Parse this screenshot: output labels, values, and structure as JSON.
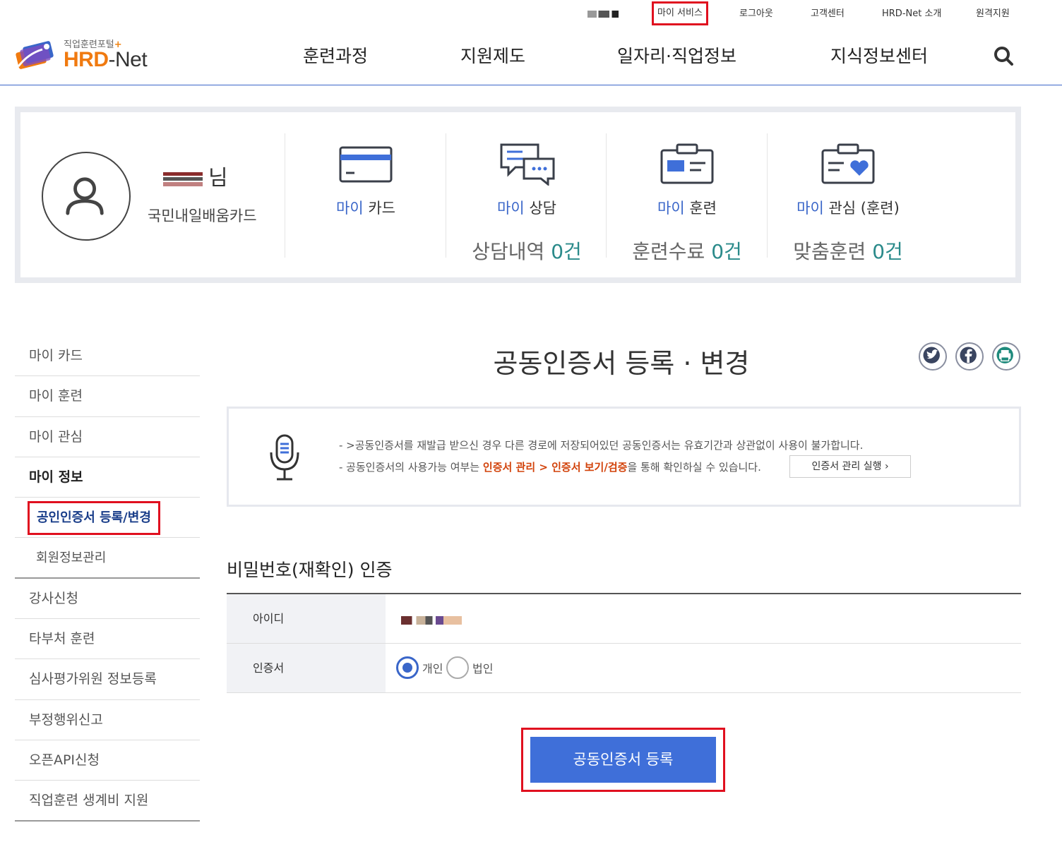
{
  "header": {
    "util": {
      "my_service": "마이 서비스",
      "logout": "로그아웃",
      "customer": "고객센터",
      "about": "HRD-Net 소개",
      "remote": "원격지원"
    },
    "logo": {
      "subtitle": "직업훈련포털",
      "plus": "+",
      "hrd": "HRD",
      "net": "-Net"
    },
    "gnb": [
      "훈련과정",
      "지원제도",
      "일자리·직업정보",
      "지식정보센터"
    ],
    "search_icon": "search-icon"
  },
  "profile": {
    "suffix": "님",
    "card_type": "국민내일배움카드",
    "items": [
      {
        "icon": "card-icon",
        "label_prefix": "마이",
        "label_rest": " 카드",
        "count_label": "",
        "count": ""
      },
      {
        "icon": "chat-icon",
        "label_prefix": "마이",
        "label_rest": " 상담",
        "count_label": "상담내역 ",
        "count": "0건"
      },
      {
        "icon": "training-icon",
        "label_prefix": "마이",
        "label_rest": " 훈련",
        "count_label": "훈련수료 ",
        "count": "0건"
      },
      {
        "icon": "interest-icon",
        "label_prefix": "마이",
        "label_rest": " 관심 (훈련)",
        "count_label": "맞춤훈련 ",
        "count": "0건"
      }
    ]
  },
  "lnb": {
    "items": [
      "마이 카드",
      "마이 훈련",
      "마이 관심",
      "마이 정보"
    ],
    "sub": [
      "공인인증서 등록/변경",
      "회원정보관리"
    ],
    "items2": [
      "강사신청",
      "타부처 훈련",
      "심사평가위원 정보등록",
      "부정행위신고",
      "오픈API신청",
      "직업훈련 생계비 지원"
    ]
  },
  "main": {
    "title": "공동인증서 등록 · 변경",
    "notice": {
      "line1": "- >공동인증서를 재발급 받으신 경우 다른 경로에 저장되어있던 공동인증서는 유효기간과 상관없이 사용이 불가합니다.",
      "line2_a": "- 공동인증서의 사용가능 여부는 ",
      "line2_em": "인증서 관리 > 인증서 보기/검증",
      "line2_b": "을 통해 확인하실 수 있습니다.",
      "button": "인증서 관리 실행"
    },
    "section_title": "비밀번호(재확인) 인증",
    "table": {
      "id_label": "아이디",
      "cert_label": "인증서",
      "opt_personal": "개인",
      "opt_corporate": "법인",
      "selected": "개인"
    },
    "submit": "공동인증서 등록"
  },
  "colors": {
    "accent": "#3a66c9",
    "highlight": "#e0101f",
    "teal": "#2a8a8a",
    "orange": "#f07a10"
  }
}
